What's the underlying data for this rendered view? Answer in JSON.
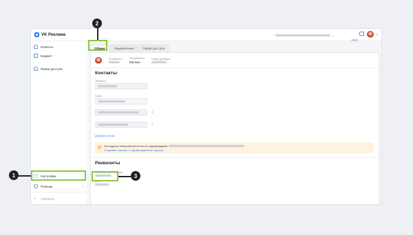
{
  "app": {
    "logo_text": "VK Реклама",
    "accent_color": "#2c7df7",
    "highlight_color": "#8ec63f"
  },
  "sidebar": {
    "items": [
      {
        "label": "Клиенты",
        "icon": "users-icon"
      },
      {
        "label": "Бюджет",
        "icon": "wallet-icon"
      },
      {
        "label": "Права доступа",
        "icon": "people-icon"
      }
    ],
    "bottom_items": [
      {
        "label": "Настройки",
        "icon": "gear-icon"
      },
      {
        "label": "Помощь",
        "icon": "help-icon"
      },
      {
        "label": "Свернуть",
        "icon": "collapse-icon"
      }
    ]
  },
  "tabs": [
    {
      "label": "Общие",
      "active": true
    },
    {
      "label": "Уведомления",
      "active": false
    },
    {
      "label": "Права доступа",
      "active": false
    }
  ],
  "profile": {
    "id_label": "ID кабинета",
    "type_label": "Тип кабинета",
    "type_value": "Юрлицо",
    "contract_label": "Номер договора"
  },
  "contacts": {
    "title": "Контакты",
    "phone_label": "Телефон",
    "email_label": "Email",
    "add_email_link": "Добавить email"
  },
  "warning": {
    "text": "Эти адреса электронной почты не подтверждены:",
    "link": "Отправить письмо с подтверждением ещё раз"
  },
  "requisites": {
    "title": "Реквизиты",
    "org_label": "Название организации",
    "inn_label": "ИНН"
  },
  "callouts": [
    "1",
    "2",
    "3"
  ]
}
